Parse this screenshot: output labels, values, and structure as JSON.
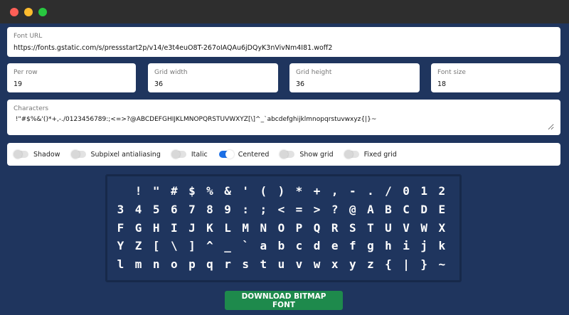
{
  "window": {
    "controls": [
      "close",
      "minimize",
      "maximize"
    ]
  },
  "font_url": {
    "label": "Font URL",
    "value": "https://fonts.gstatic.com/s/pressstart2p/v14/e3t4euO8T-267oIAQAu6jDQyK3nVivNm4I81.woff2"
  },
  "settings": [
    {
      "key": "per_row",
      "label": "Per row",
      "value": "19"
    },
    {
      "key": "grid_width",
      "label": "Grid width",
      "value": "36"
    },
    {
      "key": "grid_height",
      "label": "Grid height",
      "value": "36"
    },
    {
      "key": "font_size",
      "label": "Font size",
      "value": "18"
    }
  ],
  "characters": {
    "label": "Characters",
    "value": " !\"#$%&'()*+,-./0123456789:;<=>?@ABCDEFGHIJKLMNOPQRSTUVWXYZ[\\]^_`abcdefghijklmnopqrstuvwxyz{|}~"
  },
  "toggles": [
    {
      "label": "Shadow",
      "on": false
    },
    {
      "label": "Subpixel antialiasing",
      "on": false
    },
    {
      "label": "Italic",
      "on": false
    },
    {
      "label": "Centered",
      "on": true
    },
    {
      "label": "Show grid",
      "on": false
    },
    {
      "label": "Fixed grid",
      "on": false
    }
  ],
  "preview_rows": [
    [
      " ",
      "!",
      "\"",
      "#",
      "$",
      "%",
      "&",
      "'",
      "(",
      ")",
      "*",
      "+",
      ",",
      "-",
      ".",
      "/",
      "0",
      "1",
      "2"
    ],
    [
      "3",
      "4",
      "5",
      "6",
      "7",
      "8",
      "9",
      ":",
      ";",
      "<",
      "=",
      ">",
      "?",
      "@",
      "A",
      "B",
      "C",
      "D",
      "E"
    ],
    [
      "F",
      "G",
      "H",
      "I",
      "J",
      "K",
      "L",
      "M",
      "N",
      "O",
      "P",
      "Q",
      "R",
      "S",
      "T",
      "U",
      "V",
      "W",
      "X"
    ],
    [
      "Y",
      "Z",
      "[",
      "\\",
      "]",
      "^",
      "_",
      "`",
      "a",
      "b",
      "c",
      "d",
      "e",
      "f",
      "g",
      "h",
      "i",
      "j",
      "k"
    ],
    [
      "l",
      "m",
      "n",
      "o",
      "p",
      "q",
      "r",
      "s",
      "t",
      "u",
      "v",
      "w",
      "x",
      "y",
      "z",
      "{",
      "|",
      "}",
      "~"
    ]
  ],
  "download_label": "DOWNLOAD BITMAP FONT"
}
